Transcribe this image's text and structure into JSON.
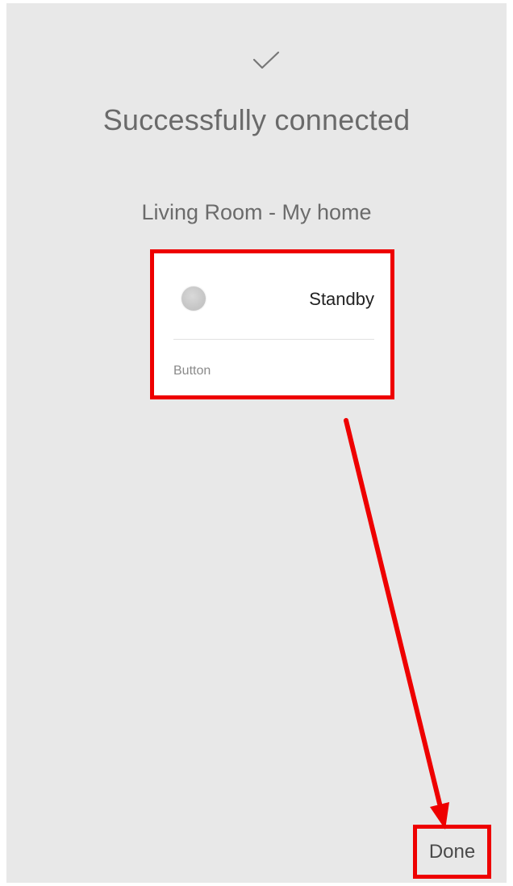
{
  "header": {
    "icon": "checkmark-icon",
    "title": "Successfully connected"
  },
  "device": {
    "location": "Living Room - My home",
    "state_label": "Standby",
    "type_label": "Button",
    "toggle_icon": "toggle-circle-icon"
  },
  "footer": {
    "done_label": "Done"
  },
  "colors": {
    "background": "#e8e8e8",
    "highlight": "#ee0000",
    "card": "#ffffff"
  }
}
